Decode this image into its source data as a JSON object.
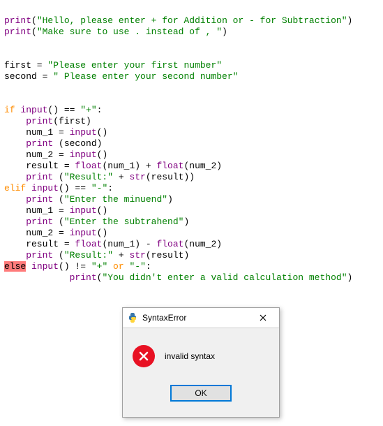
{
  "code": {
    "l01_fn": "print",
    "l01_str": "\"Hello, please enter + for Addition or - for Subtraction\"",
    "l02_fn": "print",
    "l02_str": "\"Make sure to use . instead of , \"",
    "l05_assign": "first = ",
    "l05_str": "\"Please enter your first number\"",
    "l06_assign": "second = ",
    "l06_str": "\" Please enter your second number\"",
    "l09_kw": "if",
    "l09_input": " input",
    "l09_rest": "() == ",
    "l09_str": "\"+\"",
    "l09_colon": ":",
    "l10_fn": "    print",
    "l10_args": "(first)",
    "l11_assign": "    num_1 = ",
    "l11_input": "input",
    "l11_rest": "()",
    "l12_fn": "    print",
    "l12_args": " (second)",
    "l13_assign": "    num_2 = ",
    "l13_input": "input",
    "l13_rest": "()",
    "l14_assign": "    result = ",
    "l14_float1": "float",
    "l14_mid": "(num_1) + ",
    "l14_float2": "float",
    "l14_end": "(num_2)",
    "l15_fn": "    print",
    "l15_paren": " (",
    "l15_str": "\"Result:\"",
    "l15_mid": " + ",
    "l15_strfn": "str",
    "l15_end": "(result))",
    "l16_kw": "elif",
    "l16_input": " input",
    "l16_rest": "() == ",
    "l16_str": "\"-\"",
    "l16_colon": ":",
    "l17_fn": "    print",
    "l17_paren": " (",
    "l17_str": "\"Enter the minuend\"",
    "l17_end": ")",
    "l18_assign": "    num_1 = ",
    "l18_input": "input",
    "l18_rest": "()",
    "l19_fn": "    print",
    "l19_paren": " (",
    "l19_str": "\"Enter the subtrahend\"",
    "l19_end": ")",
    "l20_assign": "    num_2 = ",
    "l20_input": "input",
    "l20_rest": "()",
    "l21_assign": "    result = ",
    "l21_float1": "float",
    "l21_mid": "(num_1) - ",
    "l21_float2": "float",
    "l21_end": "(num_2)",
    "l22_fn": "    print",
    "l22_paren": " (",
    "l22_str": "\"Result:\"",
    "l22_mid": " + ",
    "l22_strfn": "str",
    "l22_end": "(result)",
    "l23_kw": "else",
    "l23_input": " input",
    "l23_rest": "() != ",
    "l23_str1": "\"+\"",
    "l23_or": " or ",
    "l23_str2": "\"-\"",
    "l23_colon": ":",
    "l24_fn": "            print",
    "l24_paren": "(",
    "l24_str": "\"You didn't enter a valid calculation method\"",
    "l24_end": ")"
  },
  "dialog": {
    "title": "SyntaxError",
    "message": "invalid syntax",
    "ok_label": "OK"
  }
}
